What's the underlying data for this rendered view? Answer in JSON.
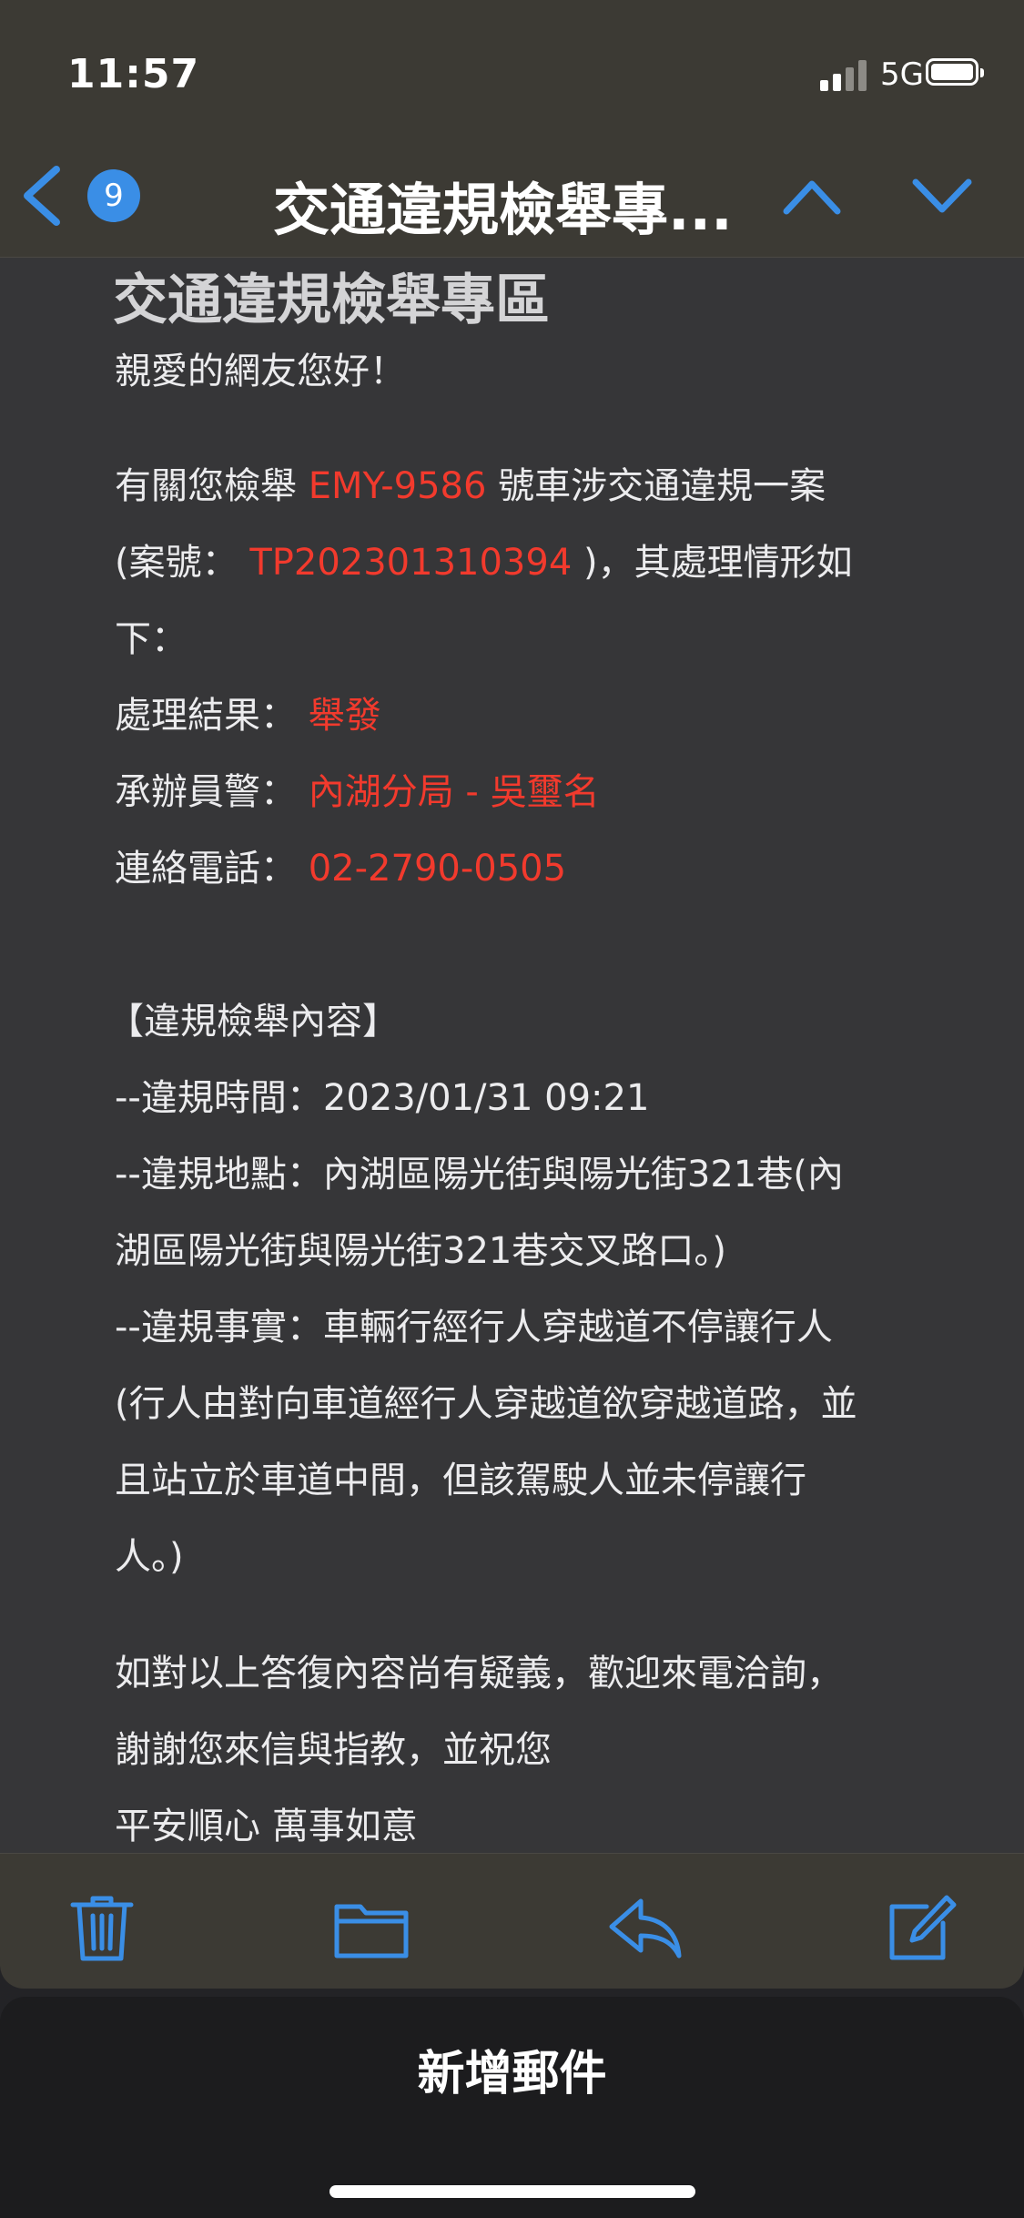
{
  "status_bar": {
    "time": "11:57",
    "network": "5G",
    "signal_bars_active": 2,
    "signal_bars_total": 4,
    "battery_icon": "battery-full-icon"
  },
  "nav": {
    "back_icon": "chevron-left-icon",
    "unread_count": "9",
    "title": "交通違規檢舉專...",
    "prev_icon": "chevron-up-icon",
    "next_icon": "chevron-down-icon"
  },
  "email": {
    "heading": "交通違規檢舉專區",
    "greeting": "親愛的網友您好！",
    "case_line1_prefix": "有關您檢舉 ",
    "plate": "EMY-9586",
    "case_line1_suffix": " 號車涉交通違規一案",
    "case_line2_prefix": "(案號： ",
    "case_number": "TP202301310394",
    "case_line2_suffix": " )，其處理情形如",
    "case_line3": "下：",
    "result_label": "處理結果： ",
    "result_value": "舉發",
    "officer_label": "承辦員警： ",
    "officer_value": "內湖分局 - 吳璽名",
    "phone_label": "連絡電話： ",
    "phone_value": "02-2790-0505",
    "section_title": "【違規檢舉內容】",
    "time_line": "--違規時間：2023/01/31 09:21",
    "location_line1": "--違規地點：內湖區陽光街與陽光街321巷(內",
    "location_line2": "湖區陽光街與陽光街321巷交叉路口。)",
    "fact_line1": "--違規事實：車輛行經行人穿越道不停讓行人",
    "fact_line2": "(行人由對向車道經行人穿越道欲穿越道路，並",
    "fact_line3": "且站立於車道中間，但該駕駛人並未停讓行",
    "fact_line4": "人。)",
    "closing_line1": "如對以上答復內容尚有疑義，歡迎來電洽詢，",
    "closing_line2": "謝謝您來信與指教，並祝您",
    "closing_line3": "平安順心 萬事如意"
  },
  "toolbar": {
    "icons": [
      "trash-icon",
      "folder-icon",
      "reply-icon",
      "compose-icon"
    ]
  },
  "bottom_sheet": {
    "title": "新增郵件"
  },
  "colors": {
    "accent": "#3a8ee6",
    "highlight": "#f23a2d",
    "chrome": "#3c3a34",
    "body_bg": "#363638"
  }
}
